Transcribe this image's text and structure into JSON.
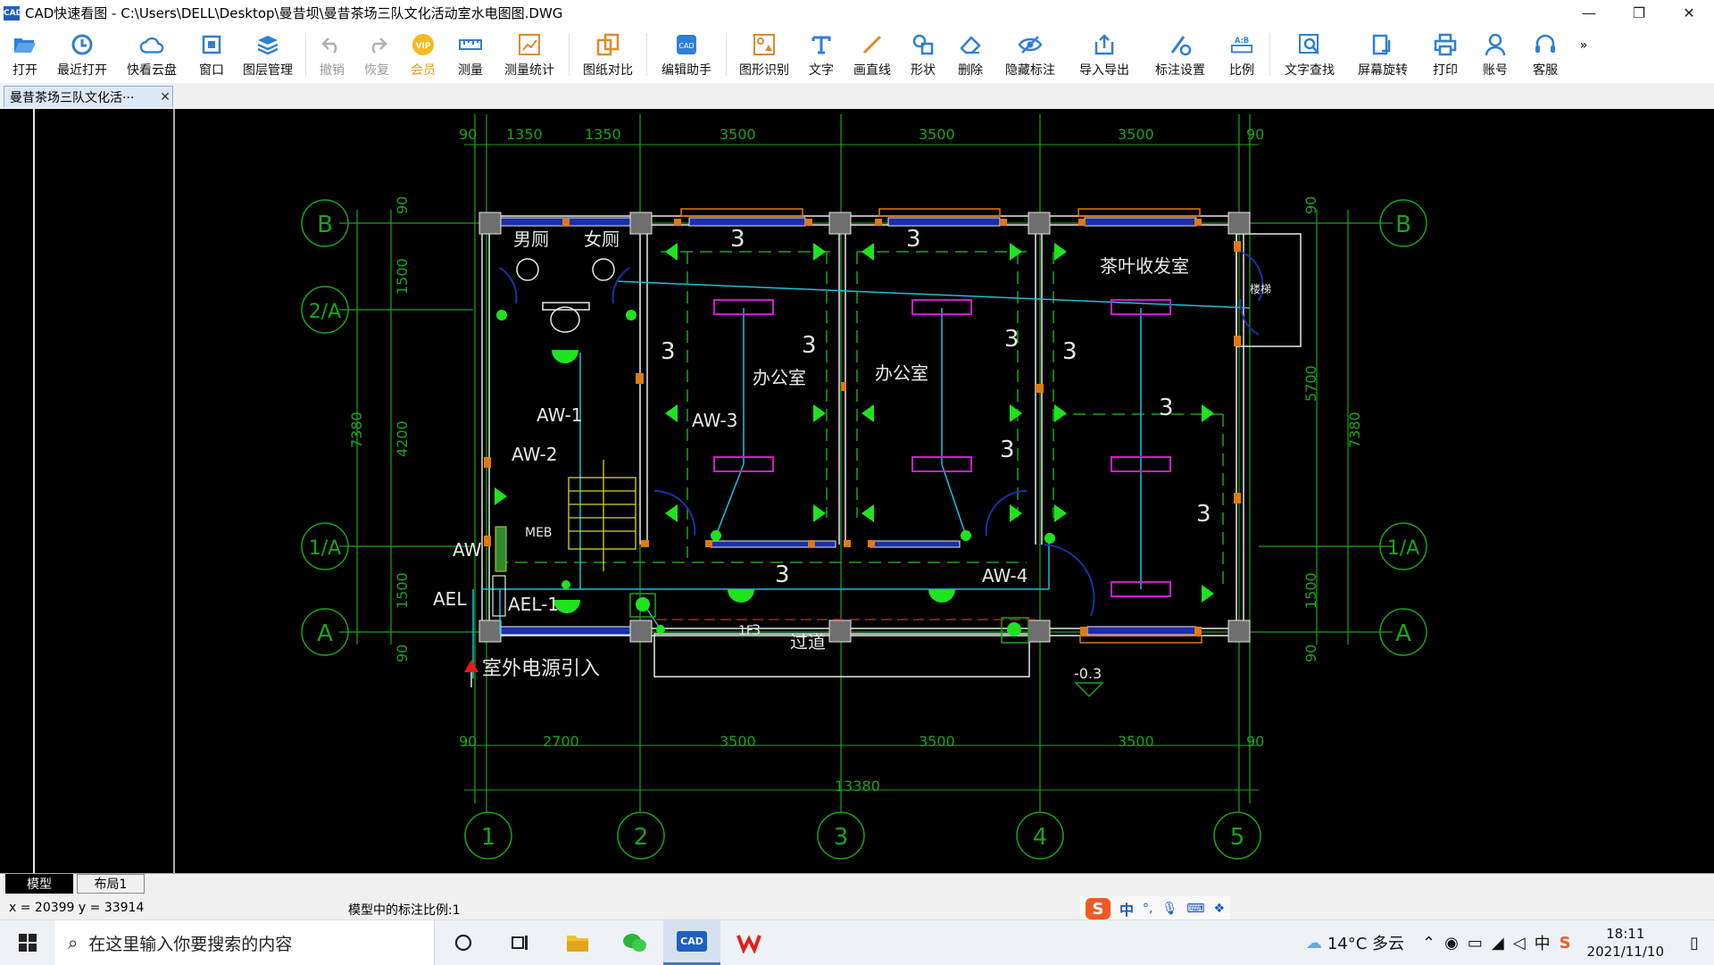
{
  "window": {
    "title": "CAD快速看图 - C:\\Users\\DELL\\Desktop\\曼昔坝\\曼昔茶场三队文化活动室水电图图.DWG",
    "app_icon_text": "CAD"
  },
  "toolbar": {
    "open": "打开",
    "recent": "最近打开",
    "cloud": "快看云盘",
    "window": "窗口",
    "layers": "图层管理",
    "undo": "撤销",
    "redo": "恢复",
    "vip": "会员",
    "measure": "测量",
    "measure_stats": "测量统计",
    "compare": "图纸对比",
    "edit_helper": "编辑助手",
    "shape_recog": "图形识别",
    "text": "文字",
    "line": "画直线",
    "shape": "形状",
    "delete": "删除",
    "hide_dim": "隐藏标注",
    "import_export": "导入导出",
    "dim_settings": "标注设置",
    "scale": "比例",
    "text_search": "文字查找",
    "rotate": "屏幕旋转",
    "print": "打印",
    "account": "账号",
    "service": "客服",
    "more": "»"
  },
  "doc_tab": {
    "label": "曼昔茶场三队文化活···"
  },
  "drawing": {
    "dims_top": [
      "90",
      "1350",
      "1350",
      "3500",
      "3500",
      "3500",
      "90"
    ],
    "dims_bottom": [
      "90",
      "2700",
      "3500",
      "3500",
      "3500",
      "90"
    ],
    "total": "13380",
    "dims_left": [
      "90",
      "1500",
      "4200",
      "1500",
      "90"
    ],
    "left_total": "7380",
    "dims_right": [
      "90",
      "5700",
      "1500",
      "90"
    ],
    "right_total": "7380",
    "axes_h": [
      "1",
      "2",
      "3",
      "4",
      "5"
    ],
    "axes_v": [
      "B",
      "2/A",
      "1/A",
      "A"
    ],
    "rooms": {
      "men": "男厕",
      "women": "女厕",
      "office1": "办公室",
      "office2": "办公室",
      "tea": "茶叶收发室",
      "corridor": "过道",
      "stair": "楼梯"
    },
    "labels": {
      "aw1": "AW-1",
      "aw2": "AW-2",
      "aw3": "AW-3",
      "aw4": "AW-4",
      "aw": "AW",
      "ael": "AEL",
      "ael1": "AEL-1",
      "meb": "MEB",
      "source": "室外电源引入",
      "level": "-0.3",
      "floor": "1F",
      "num3": "3"
    }
  },
  "layout_tabs": {
    "model": "模型",
    "layout1": "布局1"
  },
  "status": {
    "coords": "x = 20399  y = 33914",
    "scale_text": "模型中的标注比例:1"
  },
  "ime": {
    "lang": "中",
    "punct": "°,"
  },
  "taskbar": {
    "search_placeholder": "在这里输入你要搜索的内容",
    "cad_label": "CAD",
    "weather": "14°C 多云",
    "ime_tray": "中",
    "time": "18:11",
    "date": "2021/11/10"
  }
}
